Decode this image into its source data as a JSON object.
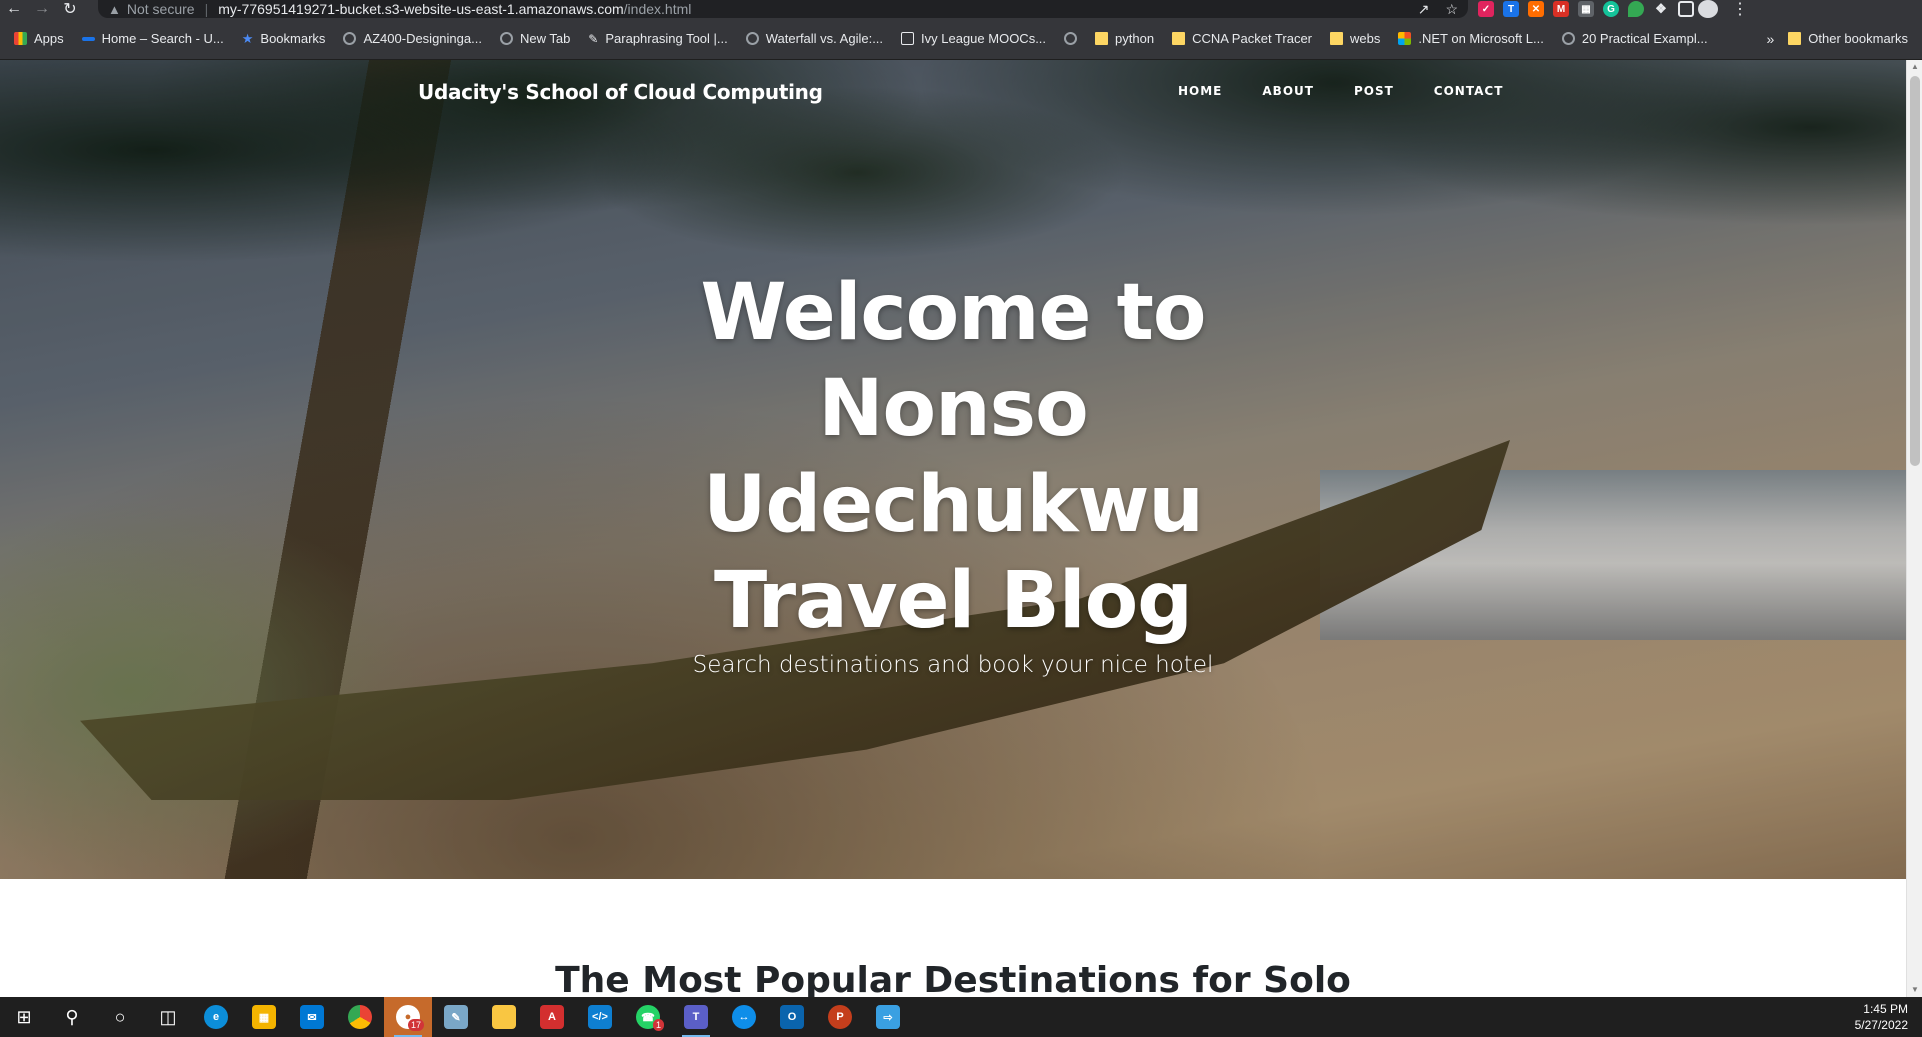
{
  "browser": {
    "security_label": "Not secure",
    "url_host": "my-776951419271-bucket.s3-website-us-east-1.amazonaws.com",
    "url_path": "/index.html",
    "bookmarks": [
      {
        "label": "Apps",
        "icon": "apps-grid-icon"
      },
      {
        "label": "Home – Search - U...",
        "icon": "site-icon"
      },
      {
        "label": "Bookmarks",
        "icon": "star-icon"
      },
      {
        "label": "AZ400-Designinga...",
        "icon": "globe-icon"
      },
      {
        "label": "New Tab",
        "icon": "globe-icon"
      },
      {
        "label": "Paraphrasing Tool |...",
        "icon": "quill-icon"
      },
      {
        "label": "Waterfall vs. Agile:...",
        "icon": "globe-icon"
      },
      {
        "label": "Ivy League MOOCs...",
        "icon": "site-icon"
      },
      {
        "label": "",
        "icon": "globe-icon"
      },
      {
        "label": "python",
        "icon": "folder-icon"
      },
      {
        "label": "CCNA Packet Tracer",
        "icon": "folder-icon"
      },
      {
        "label": "webs",
        "icon": "folder-icon"
      },
      {
        "label": ".NET on Microsoft L...",
        "icon": "microsoft-icon"
      },
      {
        "label": "20 Practical Exampl...",
        "icon": "globe-icon"
      }
    ],
    "more_bookmarks": "»",
    "other_bookmarks": "Other bookmarks"
  },
  "site": {
    "brand": "Udacity's School of Cloud Computing",
    "nav": [
      "HOME",
      "ABOUT",
      "POST",
      "CONTACT"
    ],
    "hero_title_lines": [
      "Welcome to",
      "Nonso",
      "Udechukwu",
      "Travel Blog"
    ],
    "hero_subtitle": "Search destinations and book your nice hotel",
    "section_title": "The Most Popular Destinations for Solo"
  },
  "taskbar": {
    "time": "1:45 PM",
    "date": "5/27/2022",
    "badges": {
      "chrome_extra": "17",
      "whatsapp": "1"
    }
  },
  "colors": {
    "chrome_bg": "#35363a",
    "omnibox_bg": "#202124",
    "taskbar_bg": "#1f1f1f",
    "section_text": "#212529"
  }
}
